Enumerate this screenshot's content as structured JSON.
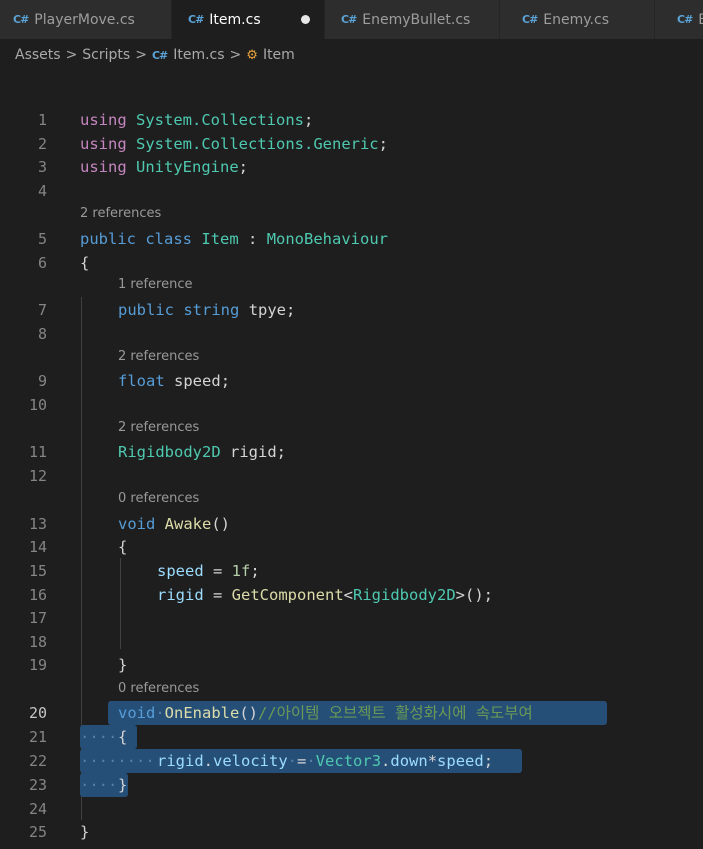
{
  "tabs": [
    {
      "label": "PlayerMove.cs",
      "icon": "C#"
    },
    {
      "label": "Item.cs",
      "icon": "C#",
      "active": true,
      "modified": true
    },
    {
      "label": "EnemyBullet.cs",
      "icon": "C#"
    },
    {
      "label": "Enemy.cs",
      "icon": "C#"
    },
    {
      "label": "B",
      "icon": "C#"
    }
  ],
  "breadcrumb": {
    "assets": "Assets",
    "scripts": "Scripts",
    "file": "Item.cs",
    "symbol": "Item",
    "separator": ">"
  },
  "code_lens": {
    "class_refs": "2 references",
    "tpye_refs": "1 reference",
    "speed_refs": "2 references",
    "rigid_refs": "2 references",
    "awake_refs": "0 references",
    "onenable_refs": "0 references"
  },
  "line_numbers": [
    "1",
    "2",
    "3",
    "4",
    "5",
    "6",
    "7",
    "8",
    "9",
    "10",
    "11",
    "12",
    "13",
    "14",
    "15",
    "16",
    "17",
    "18",
    "19",
    "20",
    "21",
    "22",
    "23",
    "24",
    "25"
  ],
  "code": {
    "using": "using",
    "ns1": "System.Collections",
    "ns2": "System.Collections.Generic",
    "ns3": "UnityEngine",
    "public": "public",
    "class": "class",
    "class_name": "Item",
    "base_class": "MonoBehaviour",
    "string": "string",
    "tpye": "tpye",
    "float": "float",
    "speed": "speed",
    "rigidbody2d": "Rigidbody2D",
    "rigid": "rigid",
    "void": "void",
    "awake": "Awake",
    "one_f": "1f",
    "get_component": "GetComponent",
    "on_enable": "OnEnable",
    "comment": "//아이템 오브젝트 활성화시에 속도부여",
    "velocity": "velocity",
    "vector3": "Vector3",
    "down": "down"
  },
  "current_line": "20",
  "colors": {
    "background": "#1e1e1e",
    "selection": "#264f78",
    "keyword_blue": "#569cd6",
    "keyword_purple": "#c586c0",
    "type": "#4ec9b0",
    "function": "#dcdcaa",
    "variable": "#9cdcfe",
    "comment": "#6a9955"
  }
}
